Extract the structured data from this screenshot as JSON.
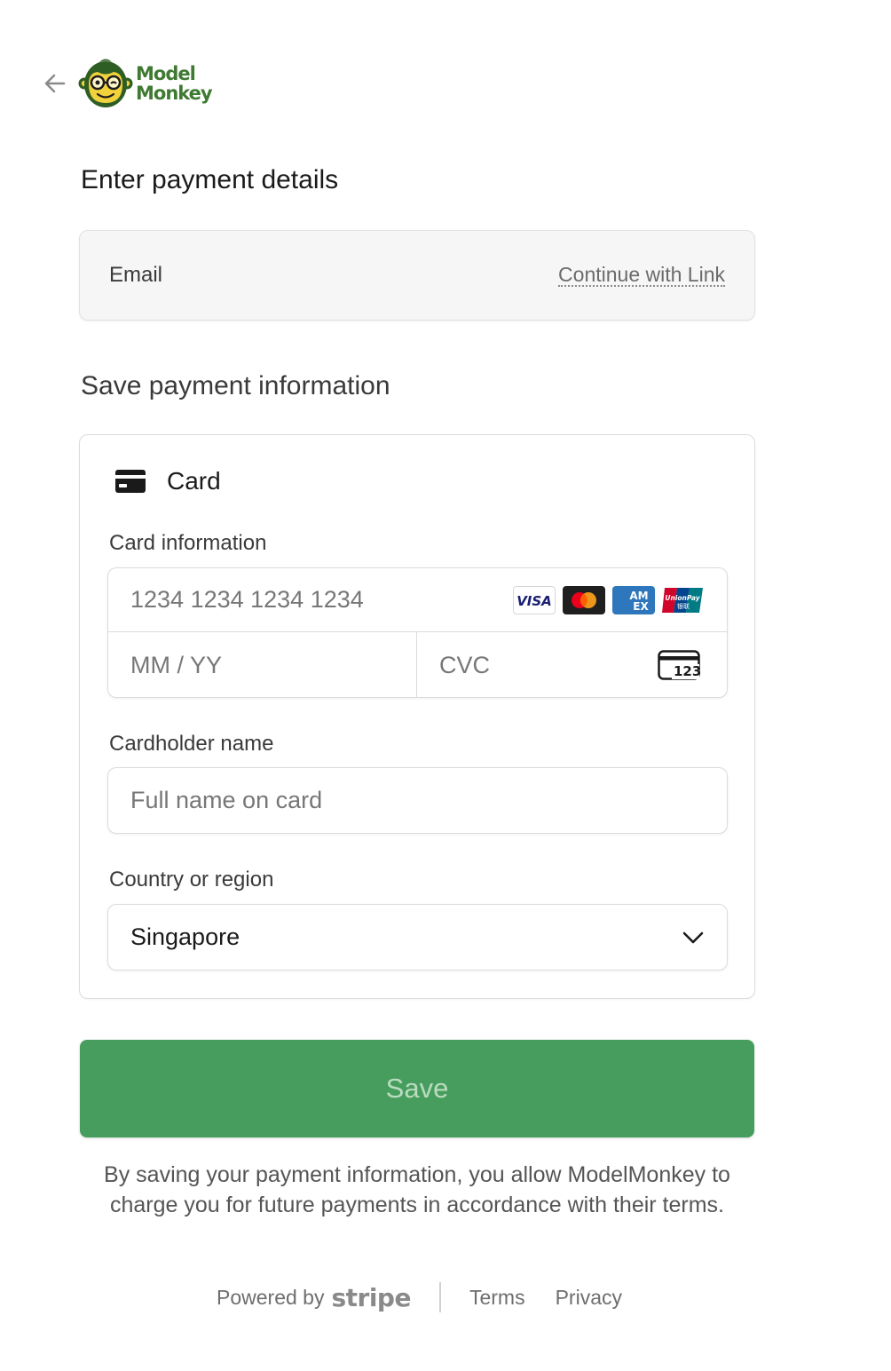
{
  "header": {
    "brand_line1": "Model",
    "brand_line2": "Monkey",
    "back_icon": "arrow-left-icon",
    "logo_icon": "monkey-logo-icon"
  },
  "page_title": "Enter payment details",
  "email": {
    "label": "Email",
    "link_label": "Continue with Link"
  },
  "section_title": "Save payment information",
  "payment_method": {
    "icon": "credit-card-icon",
    "label": "Card"
  },
  "card_info": {
    "label": "Card information",
    "number_placeholder": "1234 1234 1234 1234",
    "expiry_placeholder": "MM / YY",
    "cvc_placeholder": "CVC",
    "cvc_icon_text": "123",
    "brands": [
      "VISA",
      "Mastercard",
      "AMEX",
      "UnionPay"
    ]
  },
  "cardholder": {
    "label": "Cardholder name",
    "placeholder": "Full name on card"
  },
  "country": {
    "label": "Country or region",
    "value": "Singapore"
  },
  "save_button": {
    "label": "Save"
  },
  "consent": "By saving your payment information, you allow ModelMonkey to charge you for future payments in accordance with their terms.",
  "footer": {
    "powered_by": "Powered by",
    "stripe": "stripe",
    "terms": "Terms",
    "privacy": "Privacy"
  },
  "colors": {
    "accent": "#479d5e",
    "brand_green": "#3f7a32",
    "logo_yellow": "#f2d23c"
  }
}
